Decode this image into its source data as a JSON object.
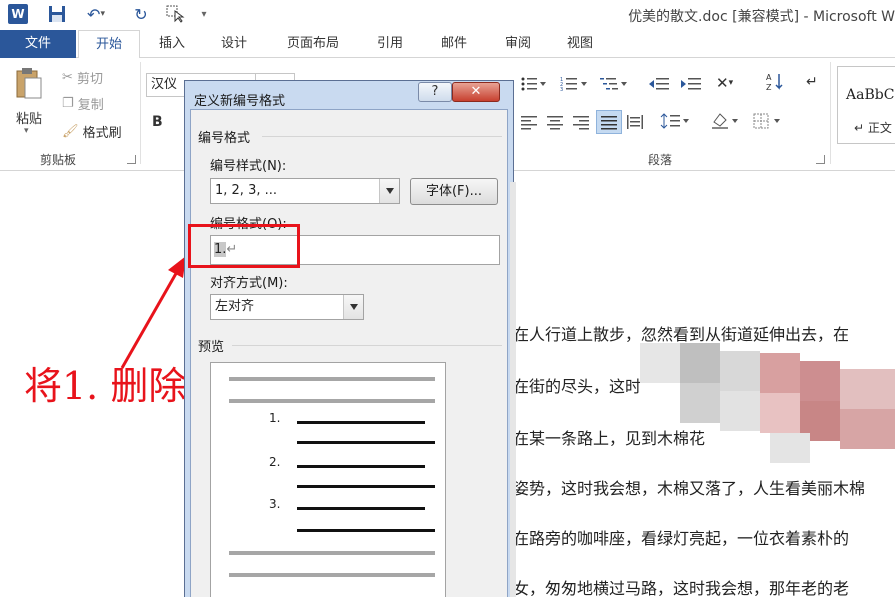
{
  "titlebar": {
    "app_icon_letter": "W",
    "title": "优美的散文.doc [兼容模式] - Microsoft W"
  },
  "tabs": {
    "file": "文件",
    "home": "开始",
    "insert": "插入",
    "design": "设计",
    "layout": "页面布局",
    "references": "引用",
    "mailings": "邮件",
    "review": "审阅",
    "view": "视图"
  },
  "ribbon": {
    "paste": "粘贴",
    "cut": "剪切",
    "copy": "复制",
    "format_painter": "格式刷",
    "clipboard_group": "剪贴板",
    "font_name": "汉仪",
    "bold": "B",
    "paragraph_group": "段落",
    "style_sample": "AaBbC",
    "style_normal": "↵ 正文"
  },
  "dialog": {
    "title": "定义新编号格式",
    "help": "?",
    "close": "✕",
    "section_number_format": "编号格式",
    "number_style_label": "编号样式(N):",
    "number_style_value": "1, 2, 3, ...",
    "font_button": "字体(F)...",
    "number_format_label": "编号格式(O):",
    "number_format_value": "1.",
    "paragraph_mark": "↵",
    "alignment_label": "对齐方式(M):",
    "alignment_value": "左对齐",
    "preview_label": "预览",
    "preview_numbers": [
      "1.",
      "2.",
      "3."
    ]
  },
  "annotation": {
    "text": "将1. 删除"
  },
  "document": {
    "lines": [
      "在人行道上散步，忽然看到从街道延伸出去，在",
      "在街的尽头，这时",
      "在某一条路上，见到木棉花",
      "姿势，这时我会想，木棉又落了，人生看美丽木棉",
      "在路旁的咖啡座，看绿灯亮起，一位衣着素朴的",
      "女，匆匆地横过马路，这时我会想，那年老的老"
    ]
  },
  "colors": {
    "accent": "#2b579a",
    "annotation_red": "#e8131b",
    "close_red": "#c7402f"
  }
}
